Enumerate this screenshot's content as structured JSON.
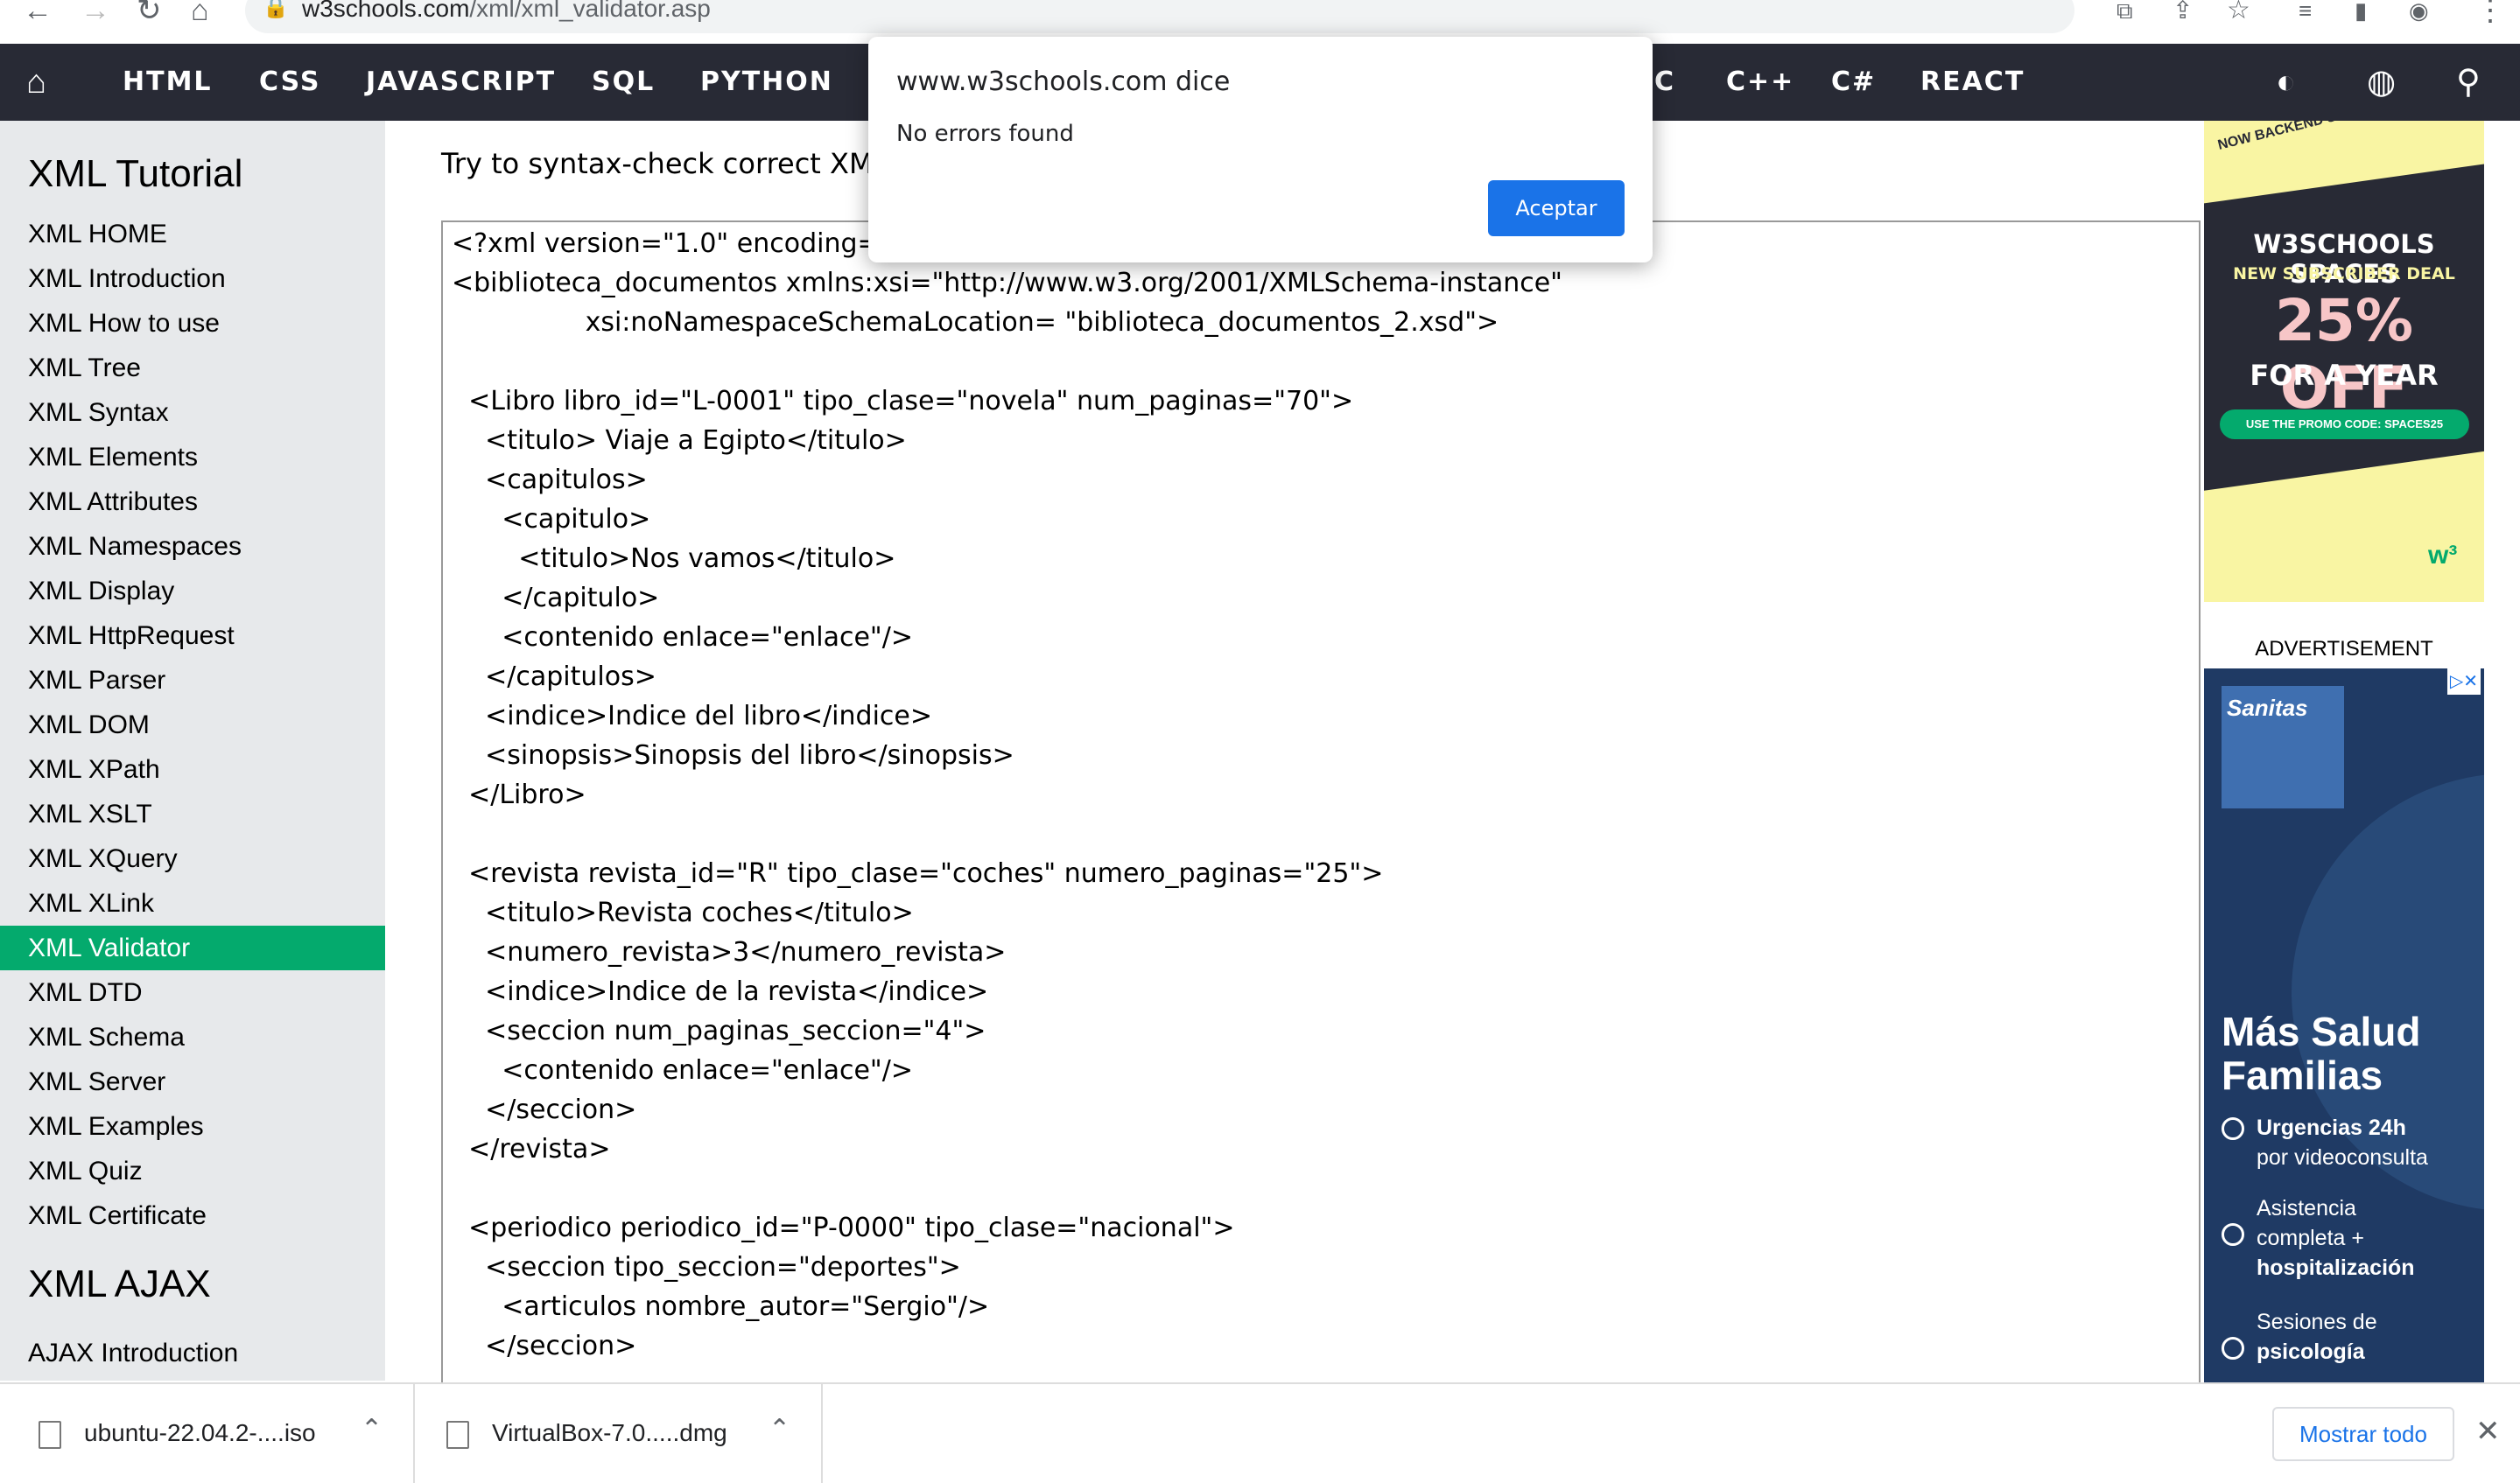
{
  "browser": {
    "url_host": "w3schools.com",
    "url_path": "/xml/xml_validator.asp"
  },
  "topnav": {
    "items": [
      "HTML",
      "CSS",
      "JAVASCRIPT",
      "SQL",
      "PYTHON",
      "C",
      "C++",
      "C#",
      "REACT"
    ]
  },
  "sidebar": {
    "heading": "XML Tutorial",
    "items": [
      "XML HOME",
      "XML Introduction",
      "XML How to use",
      "XML Tree",
      "XML Syntax",
      "XML Elements",
      "XML Attributes",
      "XML Namespaces",
      "XML Display",
      "XML HttpRequest",
      "XML Parser",
      "XML DOM",
      "XML XPath",
      "XML XSLT",
      "XML XQuery",
      "XML XLink",
      "XML Validator",
      "XML DTD",
      "XML Schema",
      "XML Server",
      "XML Examples",
      "XML Quiz",
      "XML Certificate"
    ],
    "active_item": "XML Validator",
    "heading2": "XML AJAX",
    "items2": [
      "AJAX Introduction"
    ]
  },
  "main": {
    "intro": "Try to syntax-check correct XML",
    "code_lines": [
      "<?xml version=\"1.0\" encoding=",
      "<biblioteca_documentos xmlns:xsi=\"http://www.w3.org/2001/XMLSchema-instance\"",
      "                xsi:noNamespaceSchemaLocation= \"biblioteca_documentos_2.xsd\">",
      "",
      "  <Libro libro_id=\"L-0001\" tipo_clase=\"novela\" num_paginas=\"70\">",
      "    <titulo> Viaje a Egipto</titulo>",
      "    <capitulos>",
      "      <capitulo>",
      "        <titulo>Nos vamos</titulo>",
      "      </capitulo>",
      "      <contenido enlace=\"enlace\"/>",
      "    </capitulos>",
      "    <indice>Indice del libro</indice>",
      "    <sinopsis>Sinopsis del libro</sinopsis>",
      "  </Libro>",
      "",
      "  <revista revista_id=\"R\" tipo_clase=\"coches\" numero_paginas=\"25\">",
      "    <titulo>Revista coches</titulo>",
      "    <numero_revista>3</numero_revista>",
      "    <indice>Indice de la revista</indice>",
      "    <seccion num_paginas_seccion=\"4\">",
      "      <contenido enlace=\"enlace\"/>",
      "    </seccion>",
      "  </revista>",
      "",
      "  <periodico periodico_id=\"P-0000\" tipo_clase=\"nacional\">",
      "    <seccion tipo_seccion=\"deportes\">",
      "      <articulos nombre_autor=\"Sergio\"/>",
      "    </seccion>"
    ]
  },
  "dialog": {
    "title": "www.w3schools.com dice",
    "message": "No errors found",
    "ok_label": "Aceptar"
  },
  "ad1": {
    "corner": "NOW BACKEND SU",
    "brand": "W3SCHOOLS SPACES",
    "deal": "NEW SUBSCRIBER DEAL",
    "discount": "25% OFF",
    "period": "FOR A YEAR",
    "promo": "USE THE PROMO CODE: SPACES25"
  },
  "advertisement_label": "ADVERTISEMENT",
  "ad2": {
    "logo": "Sanitas",
    "headline_1": "Más Salud",
    "headline_2": "Familias",
    "items": [
      {
        "line1": "Urgencias 24h",
        "line2": "por videoconsulta"
      },
      {
        "line1": "Asistencia",
        "line2": "completa +",
        "line3": "hospitalización"
      },
      {
        "line1": "Sesiones de",
        "line2": "psicología"
      }
    ]
  },
  "downloads": {
    "items": [
      "ubuntu-22.04.2-....iso",
      "VirtualBox-7.0.....dmg"
    ],
    "show_all": "Mostrar todo"
  },
  "colors": {
    "nav_bg": "#282a35",
    "sidebar_bg": "#e7e9eb",
    "active_green": "#04aa6d",
    "dialog_button": "#1a73e8"
  }
}
